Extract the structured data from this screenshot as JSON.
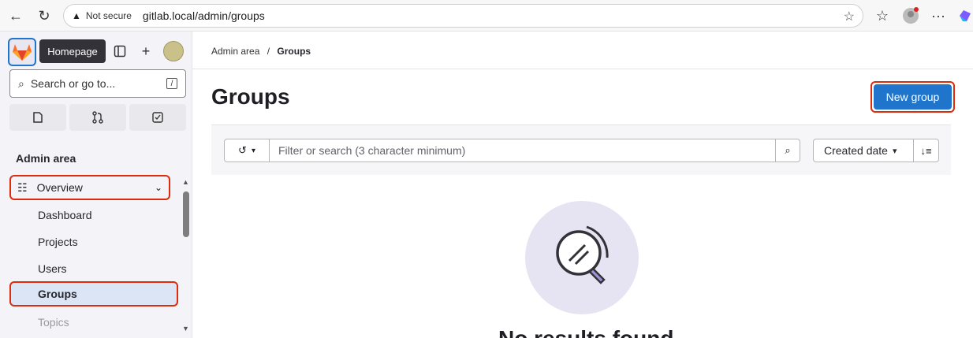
{
  "browser": {
    "security_label": "Not secure",
    "url": "gitlab.local/admin/groups"
  },
  "sidebar": {
    "tooltip": "Homepage",
    "search_placeholder": "Search or go to...",
    "search_shortcut": "/",
    "section_title": "Admin area",
    "overview_label": "Overview",
    "items": [
      {
        "label": "Dashboard"
      },
      {
        "label": "Projects"
      },
      {
        "label": "Users"
      },
      {
        "label": "Groups"
      },
      {
        "label": "Topics"
      }
    ]
  },
  "breadcrumb": {
    "parent": "Admin area",
    "separator": "/",
    "current": "Groups"
  },
  "main": {
    "title": "Groups",
    "new_group_label": "New group",
    "filter_placeholder": "Filter or search (3 character minimum)",
    "sort_label": "Created date",
    "empty_text": "No results found"
  },
  "colors": {
    "primary": "#1f75cb",
    "highlight_border": "#dd2b0e"
  }
}
